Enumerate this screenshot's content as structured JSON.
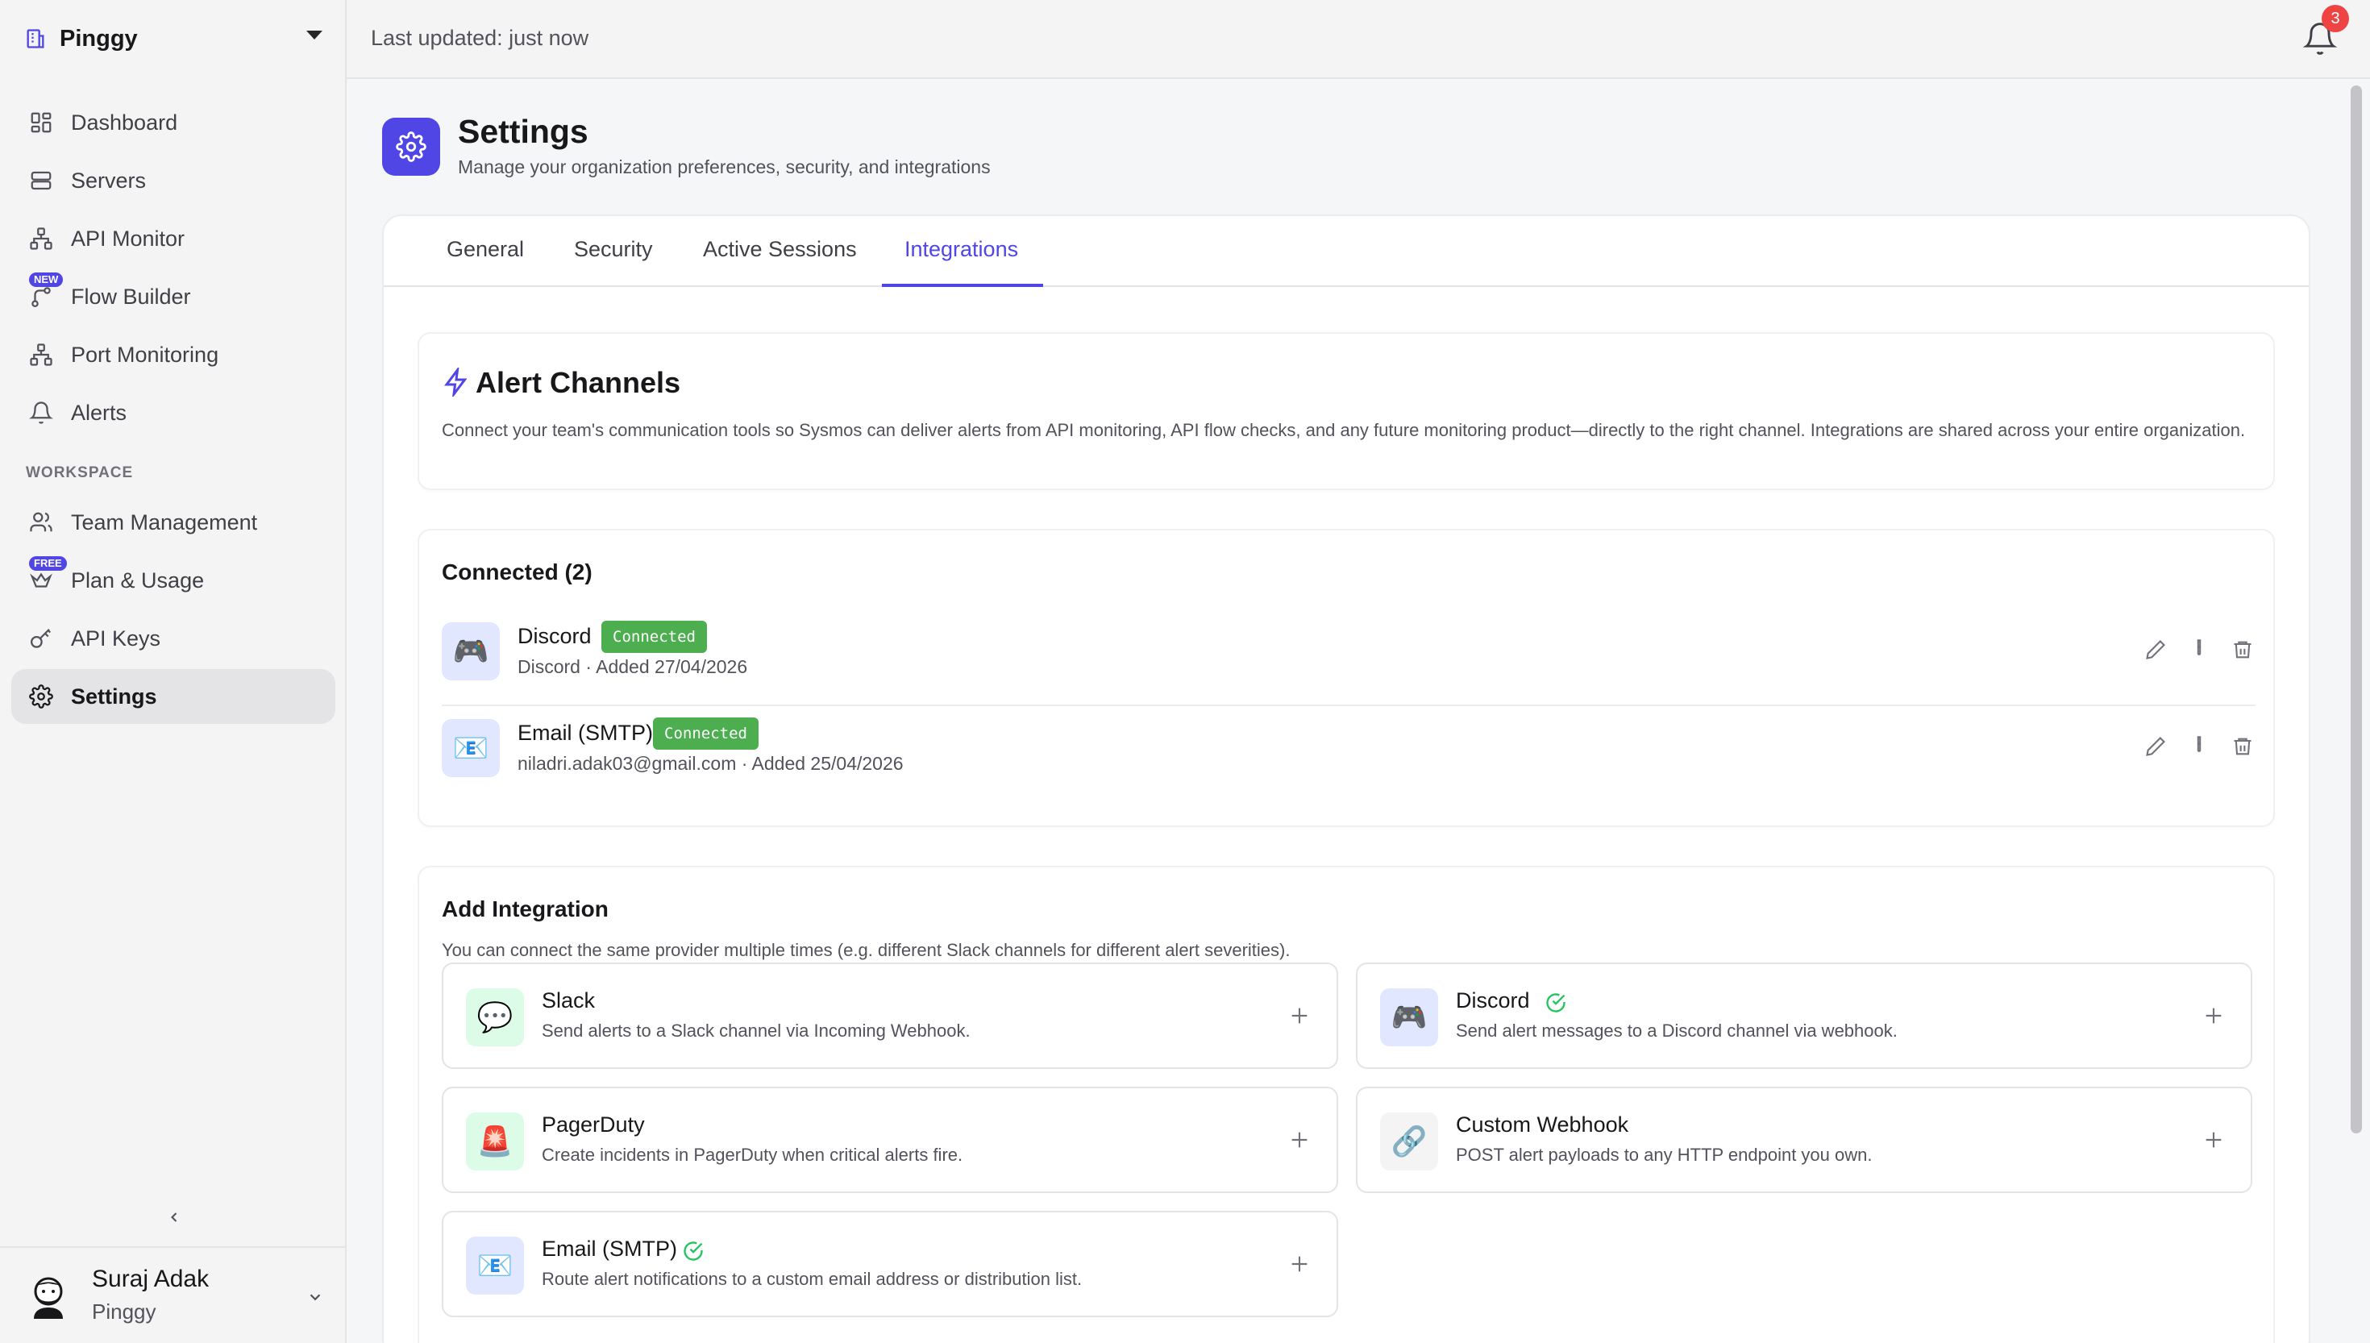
{
  "sidebar": {
    "org_name": "Pinggy",
    "nav": [
      {
        "label": "Dashboard",
        "icon": "dashboard-icon"
      },
      {
        "label": "Servers",
        "icon": "servers-icon"
      },
      {
        "label": "API Monitor",
        "icon": "api-monitor-icon"
      },
      {
        "label": "Flow Builder",
        "icon": "flow-builder-icon",
        "badge": "NEW"
      },
      {
        "label": "Port Monitoring",
        "icon": "port-monitoring-icon"
      },
      {
        "label": "Alerts",
        "icon": "bell-icon"
      }
    ],
    "workspace_label": "WORKSPACE",
    "workspace_nav": [
      {
        "label": "Team Management",
        "icon": "team-icon"
      },
      {
        "label": "Plan & Usage",
        "icon": "plan-icon",
        "badge": "FREE"
      },
      {
        "label": "API Keys",
        "icon": "key-icon"
      },
      {
        "label": "Settings",
        "icon": "gear-icon",
        "active": true
      }
    ],
    "user": {
      "name": "Suraj Adak",
      "org": "Pinggy"
    }
  },
  "topbar": {
    "last_updated": "Last updated: just now",
    "notification_count": "3"
  },
  "header": {
    "title": "Settings",
    "subtitle": "Manage your organization preferences, security, and integrations"
  },
  "tabs": [
    {
      "label": "General"
    },
    {
      "label": "Security"
    },
    {
      "label": "Active Sessions"
    },
    {
      "label": "Integrations",
      "active": true
    }
  ],
  "alert_channels": {
    "title": "Alert Channels",
    "description": "Connect your team's communication tools so Sysmos can deliver alerts from API monitoring, API flow checks, and any future monitoring product—directly to the right channel. Integrations are shared across your entire organization."
  },
  "connected": {
    "heading": "Connected (2)",
    "items": [
      {
        "name": "Discord",
        "badge": "Connected",
        "meta": "Discord · Added 27/04/2026",
        "icon": "discord-icon"
      },
      {
        "name": "Email (SMTP)",
        "badge": "Connected",
        "meta": "niladri.adak03@gmail.com · Added 25/04/2026",
        "icon": "email-icon"
      }
    ]
  },
  "add_integration": {
    "heading": "Add Integration",
    "description": "You can connect the same provider multiple times (e.g. different Slack channels for different alert severities).",
    "items": [
      {
        "name": "Slack",
        "description": "Send alerts to a Slack channel via Incoming Webhook.",
        "icon": "slack-icon",
        "connected": false
      },
      {
        "name": "Discord",
        "description": "Send alert messages to a Discord channel via webhook.",
        "icon": "discord-icon",
        "connected": true
      },
      {
        "name": "PagerDuty",
        "description": "Create incidents in PagerDuty when critical alerts fire.",
        "icon": "pagerduty-icon",
        "connected": false
      },
      {
        "name": "Custom Webhook",
        "description": "POST alert payloads to any HTTP endpoint you own.",
        "icon": "webhook-icon",
        "connected": false
      },
      {
        "name": "Email (SMTP)",
        "description": "Route alert notifications to a custom email address or distribution list.",
        "icon": "email-icon",
        "connected": true
      }
    ]
  },
  "colors": {
    "accent": "#4f46e5",
    "success": "#4cae4f",
    "danger": "#ef4444"
  }
}
